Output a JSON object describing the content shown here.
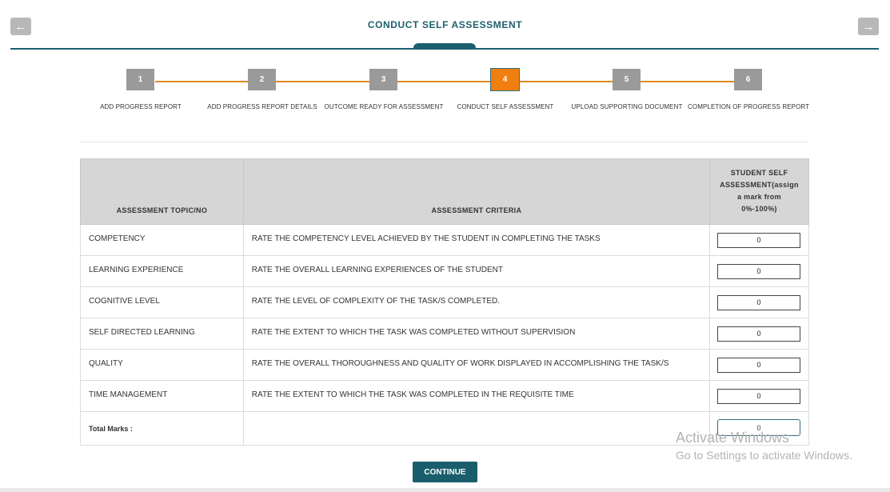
{
  "header": {
    "title": "CONDUCT SELF ASSESSMENT",
    "back_icon": "←",
    "next_icon": "→"
  },
  "stepper": {
    "active_step": 4,
    "steps": [
      {
        "number": "1",
        "label": "ADD PROGRESS REPORT"
      },
      {
        "number": "2",
        "label": "ADD PROGRESS REPORT DETAILS"
      },
      {
        "number": "3",
        "label": "OUTCOME READY FOR ASSESSMENT"
      },
      {
        "number": "4",
        "label": "CONDUCT SELF ASSESSMENT"
      },
      {
        "number": "5",
        "label": "UPLOAD SUPPORTING DOCUMENT"
      },
      {
        "number": "6",
        "label": "COMPLETION OF PROGRESS REPORT"
      }
    ]
  },
  "table": {
    "headers": {
      "topic": "ASSESSMENT TOPIC/NO",
      "criteria": "ASSESSMENT CRITERIA",
      "score_line1": "STUDENT SELF",
      "score_line2": "ASSESSMENT(assign",
      "score_line3": "a mark from",
      "score_line4": "0%-100%)"
    },
    "rows": [
      {
        "topic": "COMPETENCY",
        "criteria": "RATE THE COMPETENCY LEVEL ACHIEVED BY THE STUDENT IN COMPLETING THE TASKS",
        "value": "0"
      },
      {
        "topic": "LEARNING EXPERIENCE",
        "criteria": "RATE THE OVERALL LEARNING EXPERIENCES OF THE STUDENT",
        "value": "0"
      },
      {
        "topic": "COGNITIVE LEVEL",
        "criteria": "RATE THE LEVEL OF COMPLEXITY OF THE TASK/S COMPLETED.",
        "value": "0"
      },
      {
        "topic": "SELF DIRECTED LEARNING",
        "criteria": "RATE THE EXTENT TO WHICH THE TASK WAS COMPLETED WITHOUT SUPERVISION",
        "value": "0"
      },
      {
        "topic": "QUALITY",
        "criteria": "RATE THE OVERALL THOROUGHNESS AND QUALITY OF WORK DISPLAYED IN ACCOMPLISHING THE TASK/S",
        "value": "0"
      },
      {
        "topic": "TIME MANAGEMENT",
        "criteria": "RATE THE EXTENT TO WHICH THE TASK WAS COMPLETED IN THE REQUISITE TIME",
        "value": "0"
      }
    ],
    "total": {
      "label": "Total Marks :",
      "value": "0"
    }
  },
  "actions": {
    "continue_label": "CONTINUE"
  },
  "watermark": {
    "title": "Activate Windows",
    "subtitle": "Go to Settings to activate Windows."
  },
  "colors": {
    "accent": "#1d5f6e",
    "step_active": "#f07f10",
    "step_inactive": "#9a9a9a",
    "step_line": "#e08a1e"
  }
}
